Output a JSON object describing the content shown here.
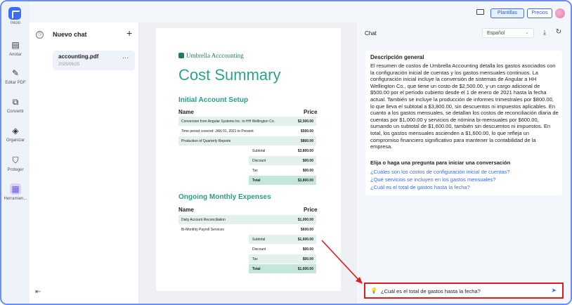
{
  "rail": {
    "items": [
      {
        "label": "Inicio",
        "icon": "home-icon"
      },
      {
        "label": "Anotar",
        "icon": "annotate-icon"
      },
      {
        "label": "Editar PDF",
        "icon": "edit-icon"
      },
      {
        "label": "Convertir",
        "icon": "convert-icon"
      },
      {
        "label": "Organizar",
        "icon": "organize-icon"
      },
      {
        "label": "Proteger",
        "icon": "shield-icon"
      },
      {
        "label": "Herramien...",
        "icon": "tools-icon"
      }
    ]
  },
  "topbar": {
    "plantillas": "Plantillas",
    "precios": "Precios"
  },
  "list": {
    "title": "Nuevo chat",
    "file": {
      "name": "accounting.pdf",
      "date": "2025/06/25"
    }
  },
  "doc": {
    "brand": "Umbrella Acccounting",
    "title": "Cost Summary",
    "section1": "Initial Account Setup",
    "name_h": "Name",
    "price_h": "Price",
    "rows1": [
      {
        "d": "Conversion from Angular Systems Inc. to HH Wellington Co.",
        "v": "$2,500.00"
      },
      {
        "d": "Time period covered: JAN 01, 2021 to Present",
        "v": "$500.00"
      },
      {
        "d": "Production of Quarterly Reports",
        "v": "$800.00"
      }
    ],
    "sum1": [
      {
        "d": "Subtotal",
        "v": "$3,800.00"
      },
      {
        "d": "Discount",
        "v": "$00.00"
      },
      {
        "d": "Tax",
        "v": "$00.00"
      },
      {
        "d": "Total",
        "v": "$3,800.00"
      }
    ],
    "section2": "Ongoing Monthly Expenses",
    "rows2": [
      {
        "d": "Daily Account Reconciliation",
        "v": "$1,000.00"
      },
      {
        "d": "Bi-Monthly Payroll Services",
        "v": "$600.00"
      }
    ],
    "sum2": [
      {
        "d": "Subtotal",
        "v": "$1,600.00"
      },
      {
        "d": "Discount",
        "v": "$00.00"
      },
      {
        "d": "Tax",
        "v": "$00.00"
      },
      {
        "d": "Total",
        "v": "$1,600.00"
      }
    ]
  },
  "chat": {
    "title": "Chat",
    "language": "Español",
    "desc_title": "Descripción general",
    "desc_body": "El resumen de costos de Umbrella Accounting detalla los gastos asociados con la configuración inicial de cuentas y los gastos mensuales continuos. La configuración inicial incluye la conversión de sistemas de Angular a HH Wellington Co., que tiene un costo de $2,500.00, y un cargo adicional de $500.00 por el período cubierto desde el 1 de enero de 2021 hasta la fecha actual. También se incluye la producción de informes trimestrales por $800.00, lo que lleva el subtotal a $3,800.00, sin descuentos ni impuestos aplicables. En cuanto a los gastos mensuales, se detallan los costos de reconciliación diaria de cuentas por $1,000.00 y servicios de nómina bi-mensuales por $600.00, sumando un subtotal de $1,600.00, también sin descuentos ni impuestos. En total, los gastos mensuales ascienden a $1,600.00, lo que refleja un compromiso financiero significativo para mantener la contabilidad de la empresa.",
    "prompt_title": "Elija o haga una pregunta para iniciar una conversación",
    "suggestions": [
      "¿Cuáles son los costos de configuración inicial de cuentas?",
      "¿Qué servicios se incluyen en los gastos mensuales?",
      "¿Cuál es el total de gastos hasta la fecha?"
    ],
    "input_value": "¿Cuál es el total de gastos hasta la fecha?"
  },
  "colors": {
    "accent": "#3b6cf6",
    "highlight": "#e21b1b",
    "doc_green": "#2aa58a"
  }
}
